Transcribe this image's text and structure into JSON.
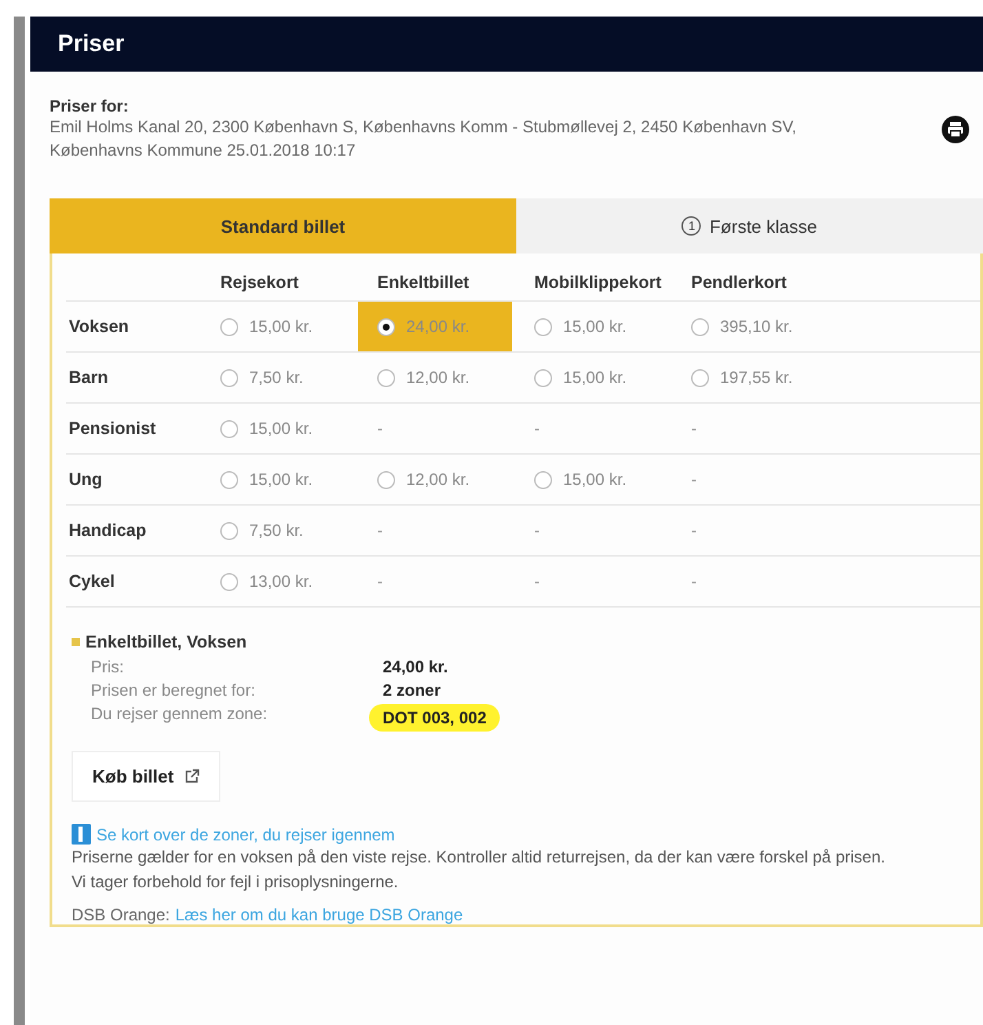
{
  "header": {
    "title": "Priser"
  },
  "route": {
    "label": "Priser for:",
    "text": "Emil Holms Kanal 20, 2300 København S, Københavns Komm - Stubmøllevej 2, 2450 København SV, Københavns Kommune 25.01.2018 10:17"
  },
  "tabs": [
    {
      "label": "Standard billet",
      "selected": true
    },
    {
      "label": "Første klasse",
      "selected": false,
      "icon_text": "1"
    }
  ],
  "table": {
    "columns": [
      "Rejsekort",
      "Enkeltbillet",
      "Mobilklippekort",
      "Pendlerkort"
    ],
    "rows": [
      {
        "label": "Voksen",
        "cells": [
          {
            "kind": "option",
            "price": "15,00 kr.",
            "selected": false
          },
          {
            "kind": "option",
            "price": "24,00 kr.",
            "selected": true
          },
          {
            "kind": "option",
            "price": "15,00 kr.",
            "selected": false
          },
          {
            "kind": "option",
            "price": "395,10 kr.",
            "selected": false
          }
        ]
      },
      {
        "label": "Barn",
        "cells": [
          {
            "kind": "option",
            "price": "7,50 kr.",
            "selected": false
          },
          {
            "kind": "option",
            "price": "12,00 kr.",
            "selected": false
          },
          {
            "kind": "option",
            "price": "15,00 kr.",
            "selected": false
          },
          {
            "kind": "option",
            "price": "197,55 kr.",
            "selected": false
          }
        ]
      },
      {
        "label": "Pensionist",
        "cells": [
          {
            "kind": "option",
            "price": "15,00 kr.",
            "selected": false
          },
          {
            "kind": "none",
            "text": "-"
          },
          {
            "kind": "none",
            "text": "-"
          },
          {
            "kind": "none",
            "text": "-"
          }
        ]
      },
      {
        "label": "Ung",
        "cells": [
          {
            "kind": "option",
            "price": "15,00 kr.",
            "selected": false
          },
          {
            "kind": "option",
            "price": "12,00 kr.",
            "selected": false
          },
          {
            "kind": "option",
            "price": "15,00 kr.",
            "selected": false
          },
          {
            "kind": "none",
            "text": "-"
          }
        ]
      },
      {
        "label": "Handicap",
        "cells": [
          {
            "kind": "option",
            "price": "7,50 kr.",
            "selected": false
          },
          {
            "kind": "none",
            "text": "-"
          },
          {
            "kind": "none",
            "text": "-"
          },
          {
            "kind": "none",
            "text": "-"
          }
        ]
      },
      {
        "label": "Cykel",
        "cells": [
          {
            "kind": "option",
            "price": "13,00 kr.",
            "selected": false
          },
          {
            "kind": "none",
            "text": "-"
          },
          {
            "kind": "none",
            "text": "-"
          },
          {
            "kind": "none",
            "text": "-"
          }
        ]
      }
    ]
  },
  "summary": {
    "title": "Enkeltbillet, Voksen",
    "details": [
      {
        "label": "Pris:",
        "value": "24,00 kr.",
        "highlighted": false
      },
      {
        "label": "Prisen er beregnet for:",
        "value": "2 zoner",
        "highlighted": false
      },
      {
        "label": "Du rejser gennem zone:",
        "value": "DOT 003, 002",
        "highlighted": true
      }
    ]
  },
  "buy_button": "Køb billet",
  "map_link": "Se kort over de zoner, du rejser igennem",
  "notes": [
    "Priserne gælder for en voksen på den viste rejse. Kontroller altid returrejsen, da der kan være forskel på prisen.",
    "Vi tager forbehold for fejl i prisoplysningerne."
  ],
  "footer": {
    "label": "DSB Orange:",
    "link": "Læs her om du kan bruge DSB Orange"
  }
}
